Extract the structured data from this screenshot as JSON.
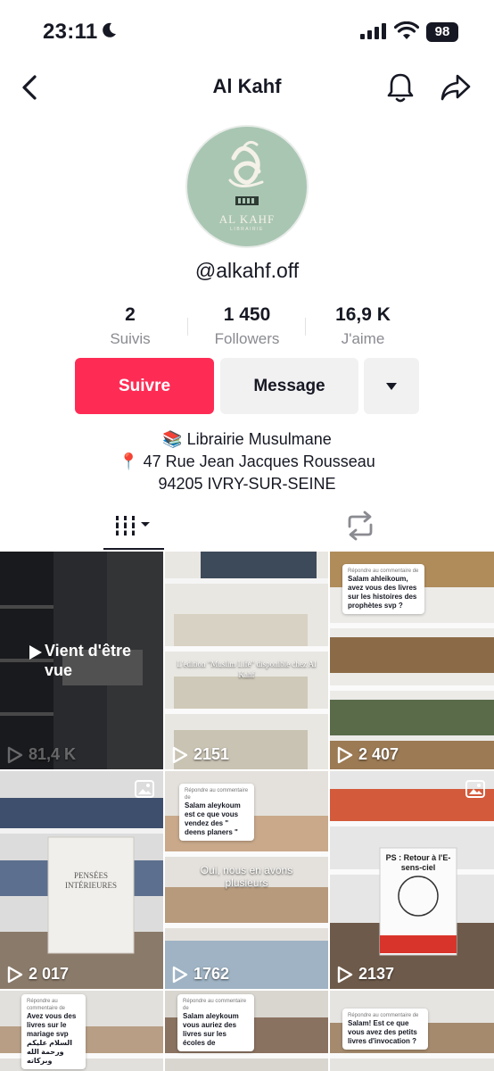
{
  "status_bar": {
    "time": "23:11",
    "battery": "98"
  },
  "header": {
    "title": "Al Kahf"
  },
  "profile": {
    "avatar_text": "AL KAHF",
    "avatar_subtext": "LIBRAIRIE",
    "handle": "@alkahf.off",
    "stats": [
      {
        "value": "2",
        "label": "Suivis"
      },
      {
        "value": "1 450",
        "label": "Followers"
      },
      {
        "value": "16,9 K",
        "label": "J'aime"
      }
    ],
    "buttons": {
      "follow": "Suivre",
      "message": "Message"
    },
    "bio": [
      "📚 Librairie Musulmane",
      "📍 47 Rue Jean Jacques Rousseau",
      "94205 IVRY-SUR-SEINE"
    ]
  },
  "videos": [
    {
      "views": "81,4 K",
      "status": "Vient d'être vue"
    },
    {
      "views": "2151",
      "caption": "L'edition \"Muslim Life\" disponible chez Al Kahf"
    },
    {
      "views": "2 407",
      "reply_to": "Répondre au commentaire de",
      "comment": "Salam ahleikoum, avez vous des livres sur les histoires des prophètes svp ?"
    },
    {
      "views": "2 017",
      "book": "PENSÉES INTÉRIEURES"
    },
    {
      "views": "1762",
      "reply_to": "Répondre au commentaire de",
      "comment": "Salam aleykoum est ce que vous vendez des \" deens planers \"",
      "caption": "Oui, nous en avons plusieurs"
    },
    {
      "views": "2137",
      "book": "PS : Retour à l'E-sens-ciel"
    },
    {
      "reply_to": "Répondre au commentaire de",
      "comment": "Avez vous des livres sur le mariage svp السلام عليكم ورحمة الله وبركاته"
    },
    {
      "reply_to": "Répondre au commentaire de",
      "comment": "Salam aleykoum vous auriez des livres sur les écoles de"
    },
    {
      "reply_to": "Répondre au commentaire de",
      "comment": "Salam! Est ce que vous avez des petits livres d'invocation ?"
    }
  ],
  "colors": {
    "accent": "#fe2c55",
    "avatar_bg": "#a9c6b2"
  }
}
